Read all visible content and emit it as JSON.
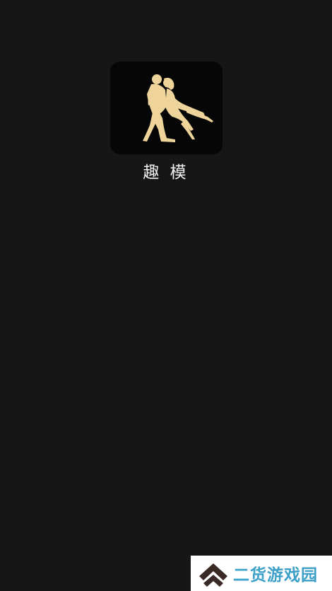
{
  "app": {
    "name": "趣 模",
    "icon": "dancing-couple-silhouette-icon"
  },
  "watermark": {
    "text": "二货游戏园",
    "icon": "double-chevron-up-icon"
  },
  "colors": {
    "background": "#161616",
    "icon_bg": "#060606",
    "silhouette": "#eed39a",
    "app_name": "#f2f2f2",
    "watermark_bg": "#ffffff",
    "watermark_text": "#3ca0c8",
    "watermark_logo": "#3a2a26"
  }
}
